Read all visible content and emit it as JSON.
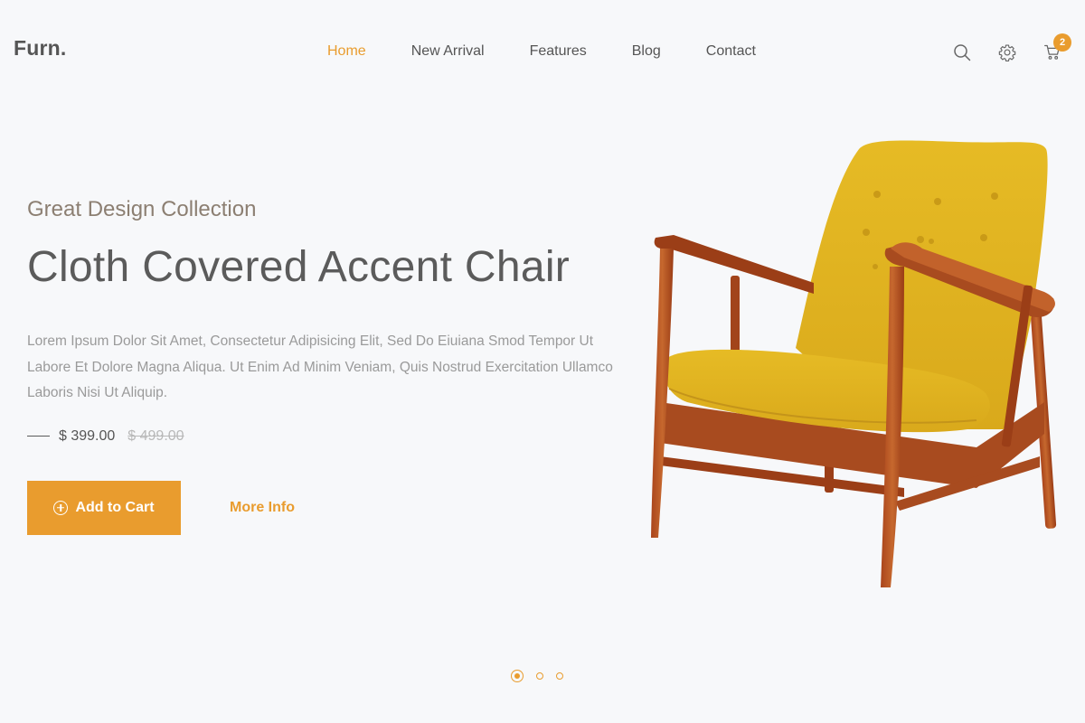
{
  "brand": {
    "logo": "Furn."
  },
  "nav": {
    "items": [
      {
        "label": "Home",
        "active": true
      },
      {
        "label": "New Arrival",
        "active": false
      },
      {
        "label": "Features",
        "active": false
      },
      {
        "label": "Blog",
        "active": false
      },
      {
        "label": "Contact",
        "active": false
      }
    ]
  },
  "header_icons": {
    "search": "search-icon",
    "settings": "gear-icon",
    "cart": "cart-icon",
    "cart_count": "2"
  },
  "hero": {
    "subtitle": "Great Design Collection",
    "title": "Cloth Covered Accent Chair",
    "description": "Lorem Ipsum Dolor Sit Amet, Consectetur Adipisicing Elit, Sed Do Eiuiana Smod Tempor Ut Labore Et Dolore Magna Aliqua. Ut Enim Ad Minim Veniam, Quis Nostrud Exercitation Ullamco Laboris Nisi Ut Aliquip.",
    "price_current": "$ 399.00",
    "price_old": "$ 499.00",
    "add_to_cart_label": "Add to Cart",
    "more_info_label": "More Info"
  },
  "slider": {
    "total": 3,
    "active_index": 0
  },
  "colors": {
    "accent": "#e99c2e",
    "background": "#f7f8fa",
    "text": "#5b5b5b"
  }
}
